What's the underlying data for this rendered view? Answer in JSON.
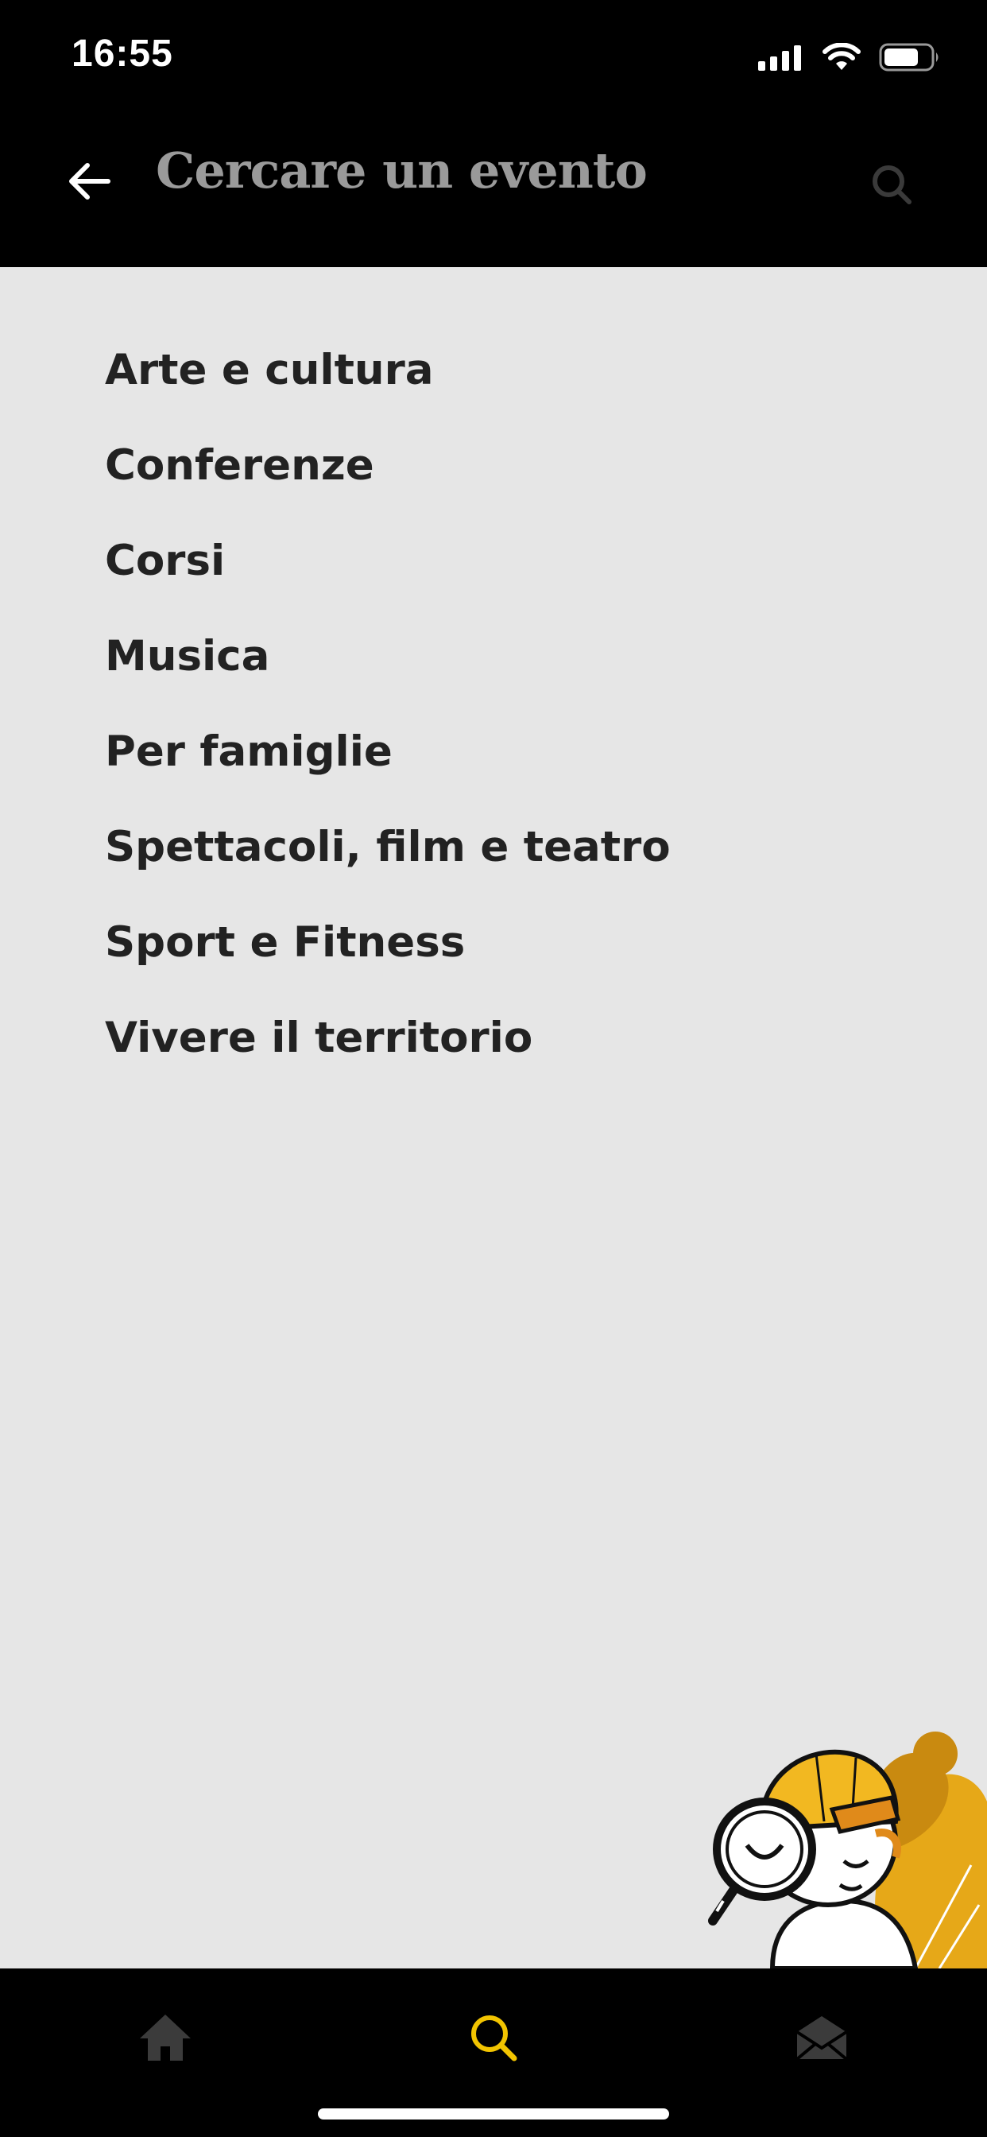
{
  "status_bar": {
    "time": "16:55",
    "icons": [
      "signal-icon",
      "wifi-icon",
      "battery-icon"
    ]
  },
  "header": {
    "title": "Cercare un evento",
    "back_icon": "arrow-left-icon",
    "search_icon": "search-icon"
  },
  "categories": [
    {
      "label": "Arte e cultura"
    },
    {
      "label": "Conferenze"
    },
    {
      "label": "Corsi"
    },
    {
      "label": "Musica"
    },
    {
      "label": "Per famiglie"
    },
    {
      "label": "Spettacoli, film e teatro"
    },
    {
      "label": "Sport e Fitness"
    },
    {
      "label": "Vivere il territorio"
    }
  ],
  "tabbar": {
    "tabs": [
      {
        "icon": "home-icon",
        "active": false
      },
      {
        "icon": "search-icon",
        "active": true
      },
      {
        "icon": "mail-icon",
        "active": false
      }
    ]
  },
  "colors": {
    "background": "#e6e6e6",
    "bar": "#000000",
    "accent": "#f2c400",
    "title_gray": "#9a9a9a",
    "text": "#222222"
  }
}
